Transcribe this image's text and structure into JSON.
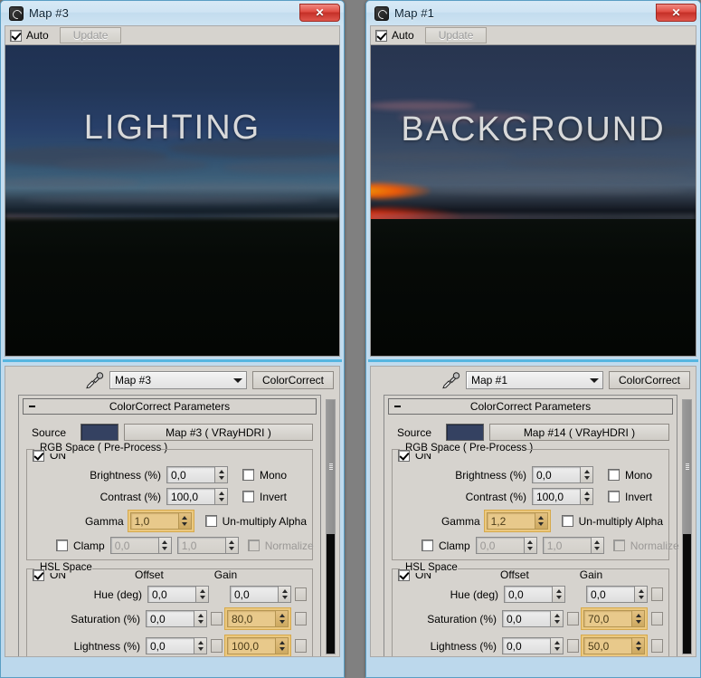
{
  "windows": [
    {
      "id": "left",
      "title": "Map #3",
      "icon": "max-logo-icon",
      "close_label": "✕",
      "toolbar": {
        "auto_label": "Auto",
        "auto_checked": true,
        "update_label": "Update",
        "update_enabled": false
      },
      "preview": {
        "caption": "LIGHTING",
        "alt": "night sky over dark field"
      },
      "map_selector": {
        "value": "Map #3",
        "button_label": "ColorCorrect",
        "eyedropper": "eyedropper-icon"
      },
      "rollout": {
        "title": "ColorCorrect Parameters",
        "source": {
          "label": "Source",
          "swatch_color": "#344161",
          "button_label": "Map #3  ( VRayHDRI )"
        },
        "rgb_space": {
          "title": "RGB Space ( Pre-Process )",
          "on_label": "ON",
          "on_checked": true,
          "brightness": {
            "label": "Brightness (%)",
            "value": "0,0",
            "animated": false
          },
          "contrast": {
            "label": "Contrast (%)",
            "value": "100,0",
            "animated": false
          },
          "gamma": {
            "label": "Gamma",
            "value": "1,0",
            "animated": true
          },
          "mono": {
            "label": "Mono",
            "checked": false
          },
          "invert": {
            "label": "Invert",
            "checked": false
          },
          "unmultiply": {
            "label": "Un-multiply Alpha",
            "checked": false
          },
          "clamp": {
            "label": "Clamp",
            "checked": false,
            "min": "0,0",
            "max": "1,0"
          },
          "normalize": {
            "label": "Normalize",
            "checked": false,
            "disabled": true
          }
        },
        "hsl_space": {
          "title": "HSL Space",
          "on_label": "ON",
          "on_checked": true,
          "col_offset": "Offset",
          "col_gain": "Gain",
          "rows": [
            {
              "label": "Hue (deg)",
              "offset": "0,0",
              "offset_animated": false,
              "gain": "0,0",
              "gain_animated": false,
              "has_offset_box": false
            },
            {
              "label": "Saturation (%)",
              "offset": "0,0",
              "offset_animated": false,
              "gain": "80,0",
              "gain_animated": true,
              "has_offset_box": true
            },
            {
              "label": "Lightness (%)",
              "offset": "0,0",
              "offset_animated": false,
              "gain": "100,0",
              "gain_animated": true,
              "has_offset_box": true
            }
          ]
        }
      }
    },
    {
      "id": "right",
      "title": "Map #1",
      "icon": "max-logo-icon",
      "close_label": "✕",
      "toolbar": {
        "auto_label": "Auto",
        "auto_checked": true,
        "update_label": "Update",
        "update_enabled": false
      },
      "preview": {
        "caption": "BACKGROUND",
        "alt": "sunset sky over dark field"
      },
      "map_selector": {
        "value": "Map #1",
        "button_label": "ColorCorrect",
        "eyedropper": "eyedropper-icon"
      },
      "rollout": {
        "title": "ColorCorrect Parameters",
        "source": {
          "label": "Source",
          "swatch_color": "#344161",
          "button_label": "Map #14  ( VRayHDRI )"
        },
        "rgb_space": {
          "title": "RGB Space ( Pre-Process )",
          "on_label": "ON",
          "on_checked": true,
          "brightness": {
            "label": "Brightness (%)",
            "value": "0,0",
            "animated": false
          },
          "contrast": {
            "label": "Contrast (%)",
            "value": "100,0",
            "animated": false
          },
          "gamma": {
            "label": "Gamma",
            "value": "1,2",
            "animated": true
          },
          "mono": {
            "label": "Mono",
            "checked": false
          },
          "invert": {
            "label": "Invert",
            "checked": false
          },
          "unmultiply": {
            "label": "Un-multiply Alpha",
            "checked": false
          },
          "clamp": {
            "label": "Clamp",
            "checked": false,
            "min": "0,0",
            "max": "1,0"
          },
          "normalize": {
            "label": "Normalize",
            "checked": false,
            "disabled": true
          }
        },
        "hsl_space": {
          "title": "HSL Space",
          "on_label": "ON",
          "on_checked": true,
          "col_offset": "Offset",
          "col_gain": "Gain",
          "rows": [
            {
              "label": "Hue (deg)",
              "offset": "0,0",
              "offset_animated": false,
              "gain": "0,0",
              "gain_animated": false,
              "has_offset_box": false
            },
            {
              "label": "Saturation (%)",
              "offset": "0,0",
              "offset_animated": false,
              "gain": "70,0",
              "gain_animated": true,
              "has_offset_box": true
            },
            {
              "label": "Lightness (%)",
              "offset": "0,0",
              "offset_animated": false,
              "gain": "50,0",
              "gain_animated": true,
              "has_offset_box": true
            }
          ]
        }
      }
    }
  ],
  "colors": {
    "desktop_background": "#808080",
    "window_frame": "#bcd8ec",
    "dialog_face": "#d6d3ce",
    "animated_field": "#e8c98b",
    "animated_border": "#d6a94b",
    "accent_rule": "#56b6e0",
    "source_swatch": "#344161"
  }
}
